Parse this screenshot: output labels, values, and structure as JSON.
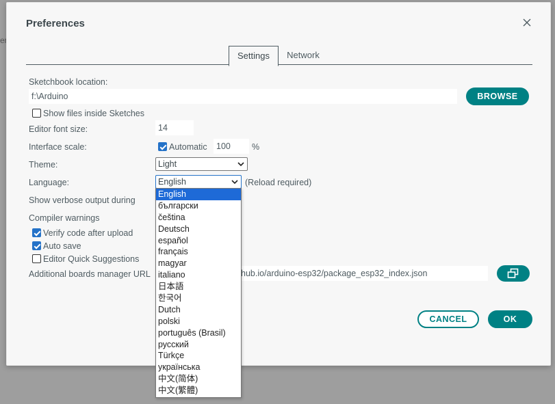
{
  "background_fragment": "er",
  "dialog": {
    "title": "Preferences",
    "close_icon": "close-icon"
  },
  "tabs": [
    {
      "label": "Settings",
      "active": true
    },
    {
      "label": "Network",
      "active": false
    }
  ],
  "sketchbook": {
    "label": "Sketchbook location:",
    "value": "f:\\Arduino",
    "browse_label": "BROWSE"
  },
  "show_files": {
    "label": "Show files inside Sketches",
    "checked": false
  },
  "font_size": {
    "label": "Editor font size:",
    "value": "14"
  },
  "interface_scale": {
    "label": "Interface scale:",
    "automatic_label": "Automatic",
    "automatic_checked": true,
    "value": "100",
    "unit": "%"
  },
  "theme": {
    "label": "Theme:",
    "value": "Light"
  },
  "language": {
    "label": "Language:",
    "value": "English",
    "note": "(Reload required)"
  },
  "verbose": {
    "label": "Show verbose output during"
  },
  "compiler_warnings": {
    "label": "Compiler warnings"
  },
  "verify_after_upload": {
    "label": "Verify code after upload",
    "checked": true
  },
  "auto_save": {
    "label": "Auto save",
    "checked": true
  },
  "quick_suggestions": {
    "label": "Editor Quick Suggestions",
    "checked": false
  },
  "boards_manager": {
    "label": "Additional boards manager URL",
    "value": "hub.io/arduino-esp32/package_esp32_index.json"
  },
  "copy_icon": "open-window-icon",
  "footer": {
    "cancel_label": "CANCEL",
    "ok_label": "OK"
  },
  "language_options": [
    "English",
    "български",
    "čeština",
    "Deutsch",
    "español",
    "français",
    "magyar",
    "italiano",
    "日本語",
    "한국어",
    "Dutch",
    "polski",
    "português (Brasil)",
    "русский",
    "Türkçe",
    "українська",
    "中文(简体)",
    "中文(繁體)"
  ],
  "colors": {
    "accent": "#008184",
    "selected_option": "#1e6ad7",
    "checkbox": "#2472c8"
  }
}
